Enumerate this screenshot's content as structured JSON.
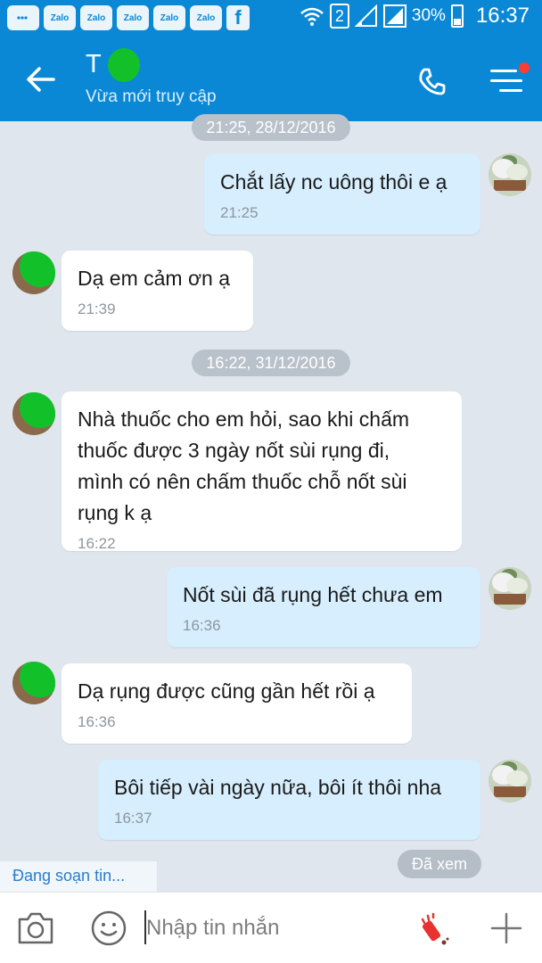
{
  "status_bar": {
    "apps": [
      "Zalo",
      "Zalo",
      "Zalo",
      "Zalo",
      "Zalo"
    ],
    "facebook_glyph": "f",
    "sim_number": "2",
    "battery": "30%",
    "time": "16:37"
  },
  "header": {
    "contact_name": "T    ng",
    "contact_status": "Vừa mới truy cập",
    "icons": {
      "back": "arrow-left-icon",
      "call": "phone-icon",
      "menu": "menu-icon"
    },
    "accent_color": "#0a88d6",
    "notification_dot_color": "#ff3b30"
  },
  "chat": {
    "date_separators": [
      "21:25, 28/12/2016",
      "16:22, 31/12/2016"
    ],
    "messages": [
      {
        "direction": "outgoing",
        "text": "Chắt lấy nc uông thôi e ạ",
        "time": "21:25"
      },
      {
        "direction": "incoming",
        "text": "Dạ em cảm ơn ạ",
        "time": "21:39"
      },
      {
        "direction": "incoming",
        "lines": [
          "Nhà thuốc cho em hỏi, sao khi chấm",
          "thuốc được 3 ngày nốt sùi rụng đi,",
          "mình có nên chấm thuốc chỗ nốt sùi",
          "rụng k ạ"
        ],
        "time": "16:22"
      },
      {
        "direction": "outgoing",
        "text": "Nốt sùi đã rụng hết chưa em",
        "time": "16:36"
      },
      {
        "direction": "incoming",
        "text": "Dạ rụng được cũng gần hết rồi ạ",
        "time": "16:36"
      },
      {
        "direction": "outgoing",
        "text": "Bôi tiếp vài ngày nữa, bôi ít thôi nha",
        "time": "16:37"
      }
    ],
    "typing_indicator": "Đang soạn tin...",
    "seen_label": "Đã xem"
  },
  "input_bar": {
    "placeholder": "Nhập tin nhắn",
    "icons": {
      "camera": "camera-icon",
      "sticker": "smiley-icon",
      "effect": "firework-icon",
      "more": "plus-icon"
    }
  }
}
